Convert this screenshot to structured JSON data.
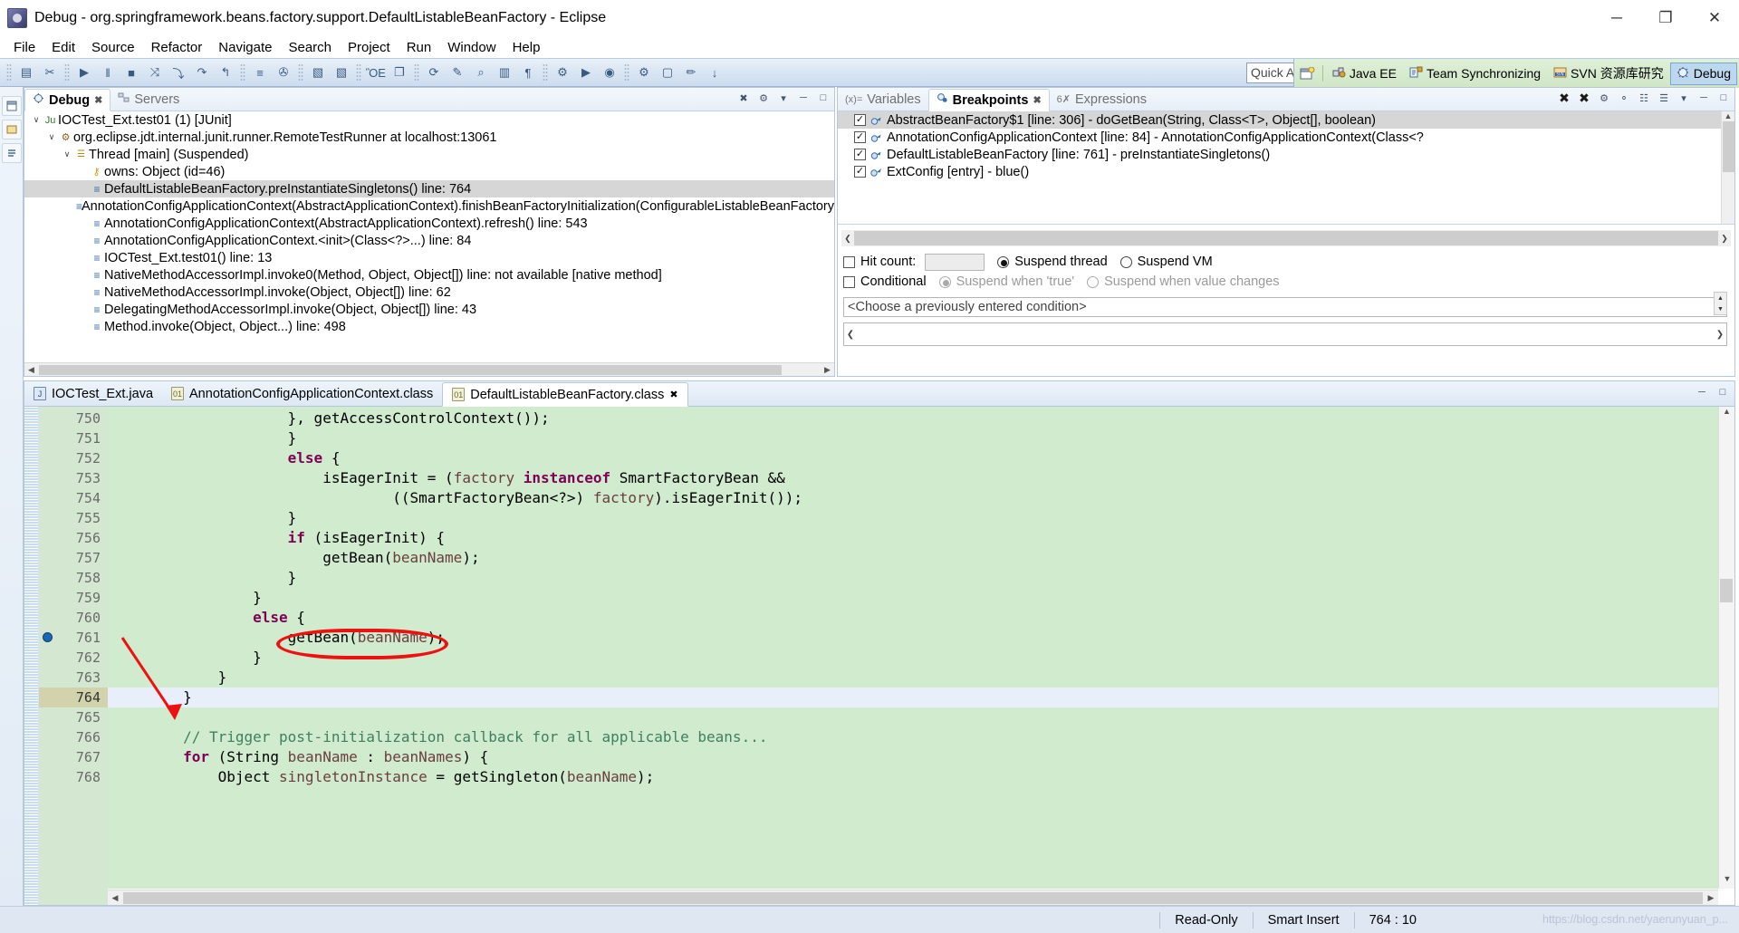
{
  "window": {
    "title": "Debug - org.springframework.beans.factory.support.DefaultListableBeanFactory - Eclipse",
    "app_icon": "eclipse-icon",
    "minimize": "─",
    "maximize": "❐",
    "close": "✕"
  },
  "menu": {
    "items": [
      "File",
      "Edit",
      "Source",
      "Refactor",
      "Navigate",
      "Search",
      "Project",
      "Run",
      "Window",
      "Help"
    ]
  },
  "toolbar": {
    "quick_access_placeholder": "Quick Access",
    "groups": [
      {
        "buttons": [
          {
            "name": "new-wizard-icon",
            "glyph": "▤"
          },
          {
            "name": "link-editor-icon",
            "glyph": "✂"
          }
        ]
      },
      {
        "buttons": [
          {
            "name": "resume-icon",
            "glyph": "▶"
          },
          {
            "name": "suspend-icon",
            "glyph": "‖"
          },
          {
            "name": "terminate-icon",
            "glyph": "■"
          },
          {
            "name": "disconnect-icon",
            "glyph": "⤨"
          },
          {
            "name": "step-into-icon",
            "glyph": "⤵"
          },
          {
            "name": "step-over-icon",
            "glyph": "↷"
          },
          {
            "name": "step-return-icon",
            "glyph": "↰"
          }
        ]
      },
      {
        "buttons": [
          {
            "name": "drop-to-frame-icon",
            "glyph": "≡"
          },
          {
            "name": "use-step-filters-icon",
            "glyph": "✇"
          }
        ]
      },
      {
        "buttons": [
          {
            "name": "new-java-file-icon",
            "glyph": "▧"
          },
          {
            "name": "new-folder-icon",
            "glyph": "▧"
          }
        ]
      },
      {
        "buttons": [
          {
            "name": "save-icon",
            "glyph": "ὋE"
          },
          {
            "name": "save-all-icon",
            "glyph": "❐"
          }
        ]
      },
      {
        "buttons": [
          {
            "name": "publish-icon",
            "glyph": "⟳"
          },
          {
            "name": "highlight-icon",
            "glyph": "✎"
          },
          {
            "name": "search-icon",
            "glyph": "⌕"
          },
          {
            "name": "open-type-icon",
            "glyph": "▥"
          },
          {
            "name": "toggle-mark-occurrences-icon",
            "glyph": "¶"
          }
        ]
      },
      {
        "buttons": [
          {
            "name": "debug-as-icon",
            "glyph": "⚙"
          },
          {
            "name": "run-as-icon",
            "glyph": "▶"
          },
          {
            "name": "coverage-as-icon",
            "glyph": "◉"
          }
        ]
      },
      {
        "buttons": [
          {
            "name": "external-tools-icon",
            "glyph": "⚙"
          },
          {
            "name": "open-perspective-icon",
            "glyph": "▢"
          },
          {
            "name": "search-pencil-icon",
            "glyph": "✏"
          },
          {
            "name": "next-annotation-icon",
            "glyph": "↓"
          }
        ]
      }
    ],
    "perspectives": [
      {
        "name": "open-perspective-button",
        "icon": "open-perspective-icon",
        "label": ""
      },
      {
        "name": "perspective-java-ee",
        "icon": "java-ee-icon",
        "label": "Java EE",
        "selected": false
      },
      {
        "name": "perspective-team-sync",
        "icon": "team-sync-icon",
        "label": "Team Synchronizing",
        "selected": false
      },
      {
        "name": "perspective-svn",
        "icon": "svn-icon",
        "label": "SVN 资源库研究",
        "selected": false
      },
      {
        "name": "perspective-debug",
        "icon": "debug-icon",
        "label": "Debug",
        "selected": true
      }
    ]
  },
  "debug_view": {
    "tabs": [
      {
        "label": "Debug",
        "icon": "debug-icon",
        "selected": true,
        "closeable": true
      },
      {
        "label": "Servers",
        "icon": "servers-icon",
        "selected": false,
        "closeable": false
      }
    ],
    "tools": [
      "collapse-all-icon",
      "view-menu-icon",
      "minimize-icon",
      "maximize-icon"
    ],
    "tree": [
      {
        "indent": 0,
        "twisty": "∨",
        "icon": "junit-icon",
        "icon_glyph": "Ju",
        "label": "IOCTest_Ext.test01 (1) [JUnit]",
        "selected": false
      },
      {
        "indent": 1,
        "twisty": "∨",
        "icon": "remote-runner-icon",
        "icon_glyph": "⚙",
        "label": "org.eclipse.jdt.internal.junit.runner.RemoteTestRunner at localhost:13061",
        "selected": false
      },
      {
        "indent": 2,
        "twisty": "∨",
        "icon": "thread-icon",
        "icon_glyph": "☰",
        "label": "Thread [main] (Suspended)",
        "selected": false
      },
      {
        "indent": 3,
        "twisty": "",
        "icon": "monitor-key-icon",
        "icon_glyph": "⚷",
        "label": "owns: Object  (id=46)",
        "selected": false
      },
      {
        "indent": 3,
        "twisty": "",
        "icon": "stack-frame-icon",
        "icon_glyph": "≡",
        "label": "DefaultListableBeanFactory.preInstantiateSingletons() line: 764",
        "selected": true
      },
      {
        "indent": 3,
        "twisty": "",
        "icon": "stack-frame-icon",
        "icon_glyph": "≡",
        "label": "AnnotationConfigApplicationContext(AbstractApplicationContext).finishBeanFactoryInitialization(ConfigurableListableBeanFactory) l",
        "selected": false
      },
      {
        "indent": 3,
        "twisty": "",
        "icon": "stack-frame-icon",
        "icon_glyph": "≡",
        "label": "AnnotationConfigApplicationContext(AbstractApplicationContext).refresh() line: 543",
        "selected": false
      },
      {
        "indent": 3,
        "twisty": "",
        "icon": "stack-frame-icon",
        "icon_glyph": "≡",
        "label": "AnnotationConfigApplicationContext.<init>(Class<?>...) line: 84",
        "selected": false
      },
      {
        "indent": 3,
        "twisty": "",
        "icon": "stack-frame-icon",
        "icon_glyph": "≡",
        "label": "IOCTest_Ext.test01() line: 13",
        "selected": false
      },
      {
        "indent": 3,
        "twisty": "",
        "icon": "stack-frame-icon",
        "icon_glyph": "≡",
        "label": "NativeMethodAccessorImpl.invoke0(Method, Object, Object[]) line: not available [native method]",
        "selected": false
      },
      {
        "indent": 3,
        "twisty": "",
        "icon": "stack-frame-icon",
        "icon_glyph": "≡",
        "label": "NativeMethodAccessorImpl.invoke(Object, Object[]) line: 62",
        "selected": false
      },
      {
        "indent": 3,
        "twisty": "",
        "icon": "stack-frame-icon",
        "icon_glyph": "≡",
        "label": "DelegatingMethodAccessorImpl.invoke(Object, Object[]) line: 43",
        "selected": false
      },
      {
        "indent": 3,
        "twisty": "",
        "icon": "stack-frame-icon",
        "icon_glyph": "≡",
        "label": "Method.invoke(Object, Object...) line: 498",
        "selected": false
      }
    ]
  },
  "breakpoints_view": {
    "tabs": [
      {
        "label": "Variables",
        "icon": "variables-icon",
        "selected": false,
        "closeable": false
      },
      {
        "label": "Breakpoints",
        "icon": "breakpoint-icon",
        "selected": true,
        "closeable": true
      },
      {
        "label": "Expressions",
        "icon": "expressions-icon",
        "selected": false,
        "closeable": false
      }
    ],
    "tools": [
      "remove-breakpoint-icon",
      "remove-all-icon",
      "link-icon",
      "skip-all-icon",
      "expand-all-icon",
      "collapse-all-icon",
      "view-menu-icon",
      "minimize-icon",
      "maximize-icon"
    ],
    "rows": [
      {
        "checked": true,
        "icon": "java-line-breakpoint-icon",
        "label": "AbstractBeanFactory$1 [line: 306] - doGetBean(String, Class<T>, Object[], boolean)",
        "selected": true
      },
      {
        "checked": true,
        "icon": "java-line-breakpoint-icon",
        "label": "AnnotationConfigApplicationContext [line: 84] - AnnotationConfigApplicationContext(Class<?",
        "selected": false
      },
      {
        "checked": true,
        "icon": "java-line-breakpoint-icon",
        "label": "DefaultListableBeanFactory [line: 761] - preInstantiateSingletons()",
        "selected": false
      },
      {
        "checked": true,
        "icon": "java-method-breakpoint-icon",
        "label": "ExtConfig [entry] - blue()",
        "selected": false
      }
    ],
    "detail": {
      "hit_count_label": "Hit count:",
      "hit_count_value": "",
      "hit_count_checked": false,
      "suspend_thread_label": "Suspend thread",
      "suspend_thread_selected": true,
      "suspend_vm_label": "Suspend VM",
      "suspend_vm_selected": false,
      "conditional_label": "Conditional",
      "conditional_checked": false,
      "suspend_when_true_label": "Suspend when 'true'",
      "suspend_when_true_selected": true,
      "suspend_when_changes_label": "Suspend when value changes",
      "suspend_when_changes_selected": false,
      "condition_combo_value": "<Choose a previously entered condition>",
      "condition_editor_value": ""
    }
  },
  "editor": {
    "tabs": [
      {
        "label": "IOCTest_Ext.java",
        "icon": "java-file-icon",
        "selected": false,
        "closeable": false
      },
      {
        "label": "AnnotationConfigApplicationContext.class",
        "icon": "class-file-icon",
        "selected": false,
        "closeable": false
      },
      {
        "label": "DefaultListableBeanFactory.class",
        "icon": "class-file-icon",
        "selected": true,
        "closeable": true
      }
    ],
    "tools": [
      "minimize-icon",
      "maximize-icon"
    ],
    "current_line": 764,
    "breakpoint_line": 761,
    "lines": [
      {
        "num": "750",
        "current": false,
        "breakpoint": false,
        "tokens": [
          {
            "t": "plain",
            "v": "                    }, getAccessControlContext());"
          }
        ]
      },
      {
        "num": "751",
        "current": false,
        "breakpoint": false,
        "tokens": [
          {
            "t": "plain",
            "v": "                    }"
          }
        ]
      },
      {
        "num": "752",
        "current": false,
        "breakpoint": false,
        "tokens": [
          {
            "t": "plain",
            "v": "                    "
          },
          {
            "t": "kw",
            "v": "else"
          },
          {
            "t": "plain",
            "v": " {"
          }
        ]
      },
      {
        "num": "753",
        "current": false,
        "breakpoint": false,
        "tokens": [
          {
            "t": "plain",
            "v": "                        isEagerInit = ("
          },
          {
            "t": "var",
            "v": "factory"
          },
          {
            "t": "plain",
            "v": " "
          },
          {
            "t": "kw",
            "v": "instanceof"
          },
          {
            "t": "plain",
            "v": " SmartFactoryBean &&"
          }
        ]
      },
      {
        "num": "754",
        "current": false,
        "breakpoint": false,
        "tokens": [
          {
            "t": "plain",
            "v": "                                ((SmartFactoryBean<?>) "
          },
          {
            "t": "var",
            "v": "factory"
          },
          {
            "t": "plain",
            "v": ").isEagerInit());"
          }
        ]
      },
      {
        "num": "755",
        "current": false,
        "breakpoint": false,
        "tokens": [
          {
            "t": "plain",
            "v": "                    }"
          }
        ]
      },
      {
        "num": "756",
        "current": false,
        "breakpoint": false,
        "tokens": [
          {
            "t": "plain",
            "v": "                    "
          },
          {
            "t": "kw",
            "v": "if"
          },
          {
            "t": "plain",
            "v": " (isEagerInit) {"
          }
        ]
      },
      {
        "num": "757",
        "current": false,
        "breakpoint": false,
        "tokens": [
          {
            "t": "plain",
            "v": "                        getBean("
          },
          {
            "t": "var",
            "v": "beanName"
          },
          {
            "t": "plain",
            "v": ");"
          }
        ]
      },
      {
        "num": "758",
        "current": false,
        "breakpoint": false,
        "tokens": [
          {
            "t": "plain",
            "v": "                    }"
          }
        ]
      },
      {
        "num": "759",
        "current": false,
        "breakpoint": false,
        "tokens": [
          {
            "t": "plain",
            "v": "                }"
          }
        ]
      },
      {
        "num": "760",
        "current": false,
        "breakpoint": false,
        "tokens": [
          {
            "t": "plain",
            "v": "                "
          },
          {
            "t": "kw",
            "v": "else"
          },
          {
            "t": "plain",
            "v": " {"
          }
        ]
      },
      {
        "num": "761",
        "current": false,
        "breakpoint": true,
        "tokens": [
          {
            "t": "plain",
            "v": "                    getBean("
          },
          {
            "t": "var",
            "v": "beanName"
          },
          {
            "t": "plain",
            "v": ");"
          }
        ]
      },
      {
        "num": "762",
        "current": false,
        "breakpoint": false,
        "tokens": [
          {
            "t": "plain",
            "v": "                }"
          }
        ]
      },
      {
        "num": "763",
        "current": false,
        "breakpoint": false,
        "tokens": [
          {
            "t": "plain",
            "v": "            }"
          }
        ]
      },
      {
        "num": "764",
        "current": true,
        "breakpoint": false,
        "tokens": [
          {
            "t": "plain",
            "v": "        }"
          }
        ]
      },
      {
        "num": "765",
        "current": false,
        "breakpoint": false,
        "tokens": [
          {
            "t": "plain",
            "v": ""
          }
        ]
      },
      {
        "num": "766",
        "current": false,
        "breakpoint": false,
        "tokens": [
          {
            "t": "cmt",
            "v": "        // Trigger post-initialization callback for all applicable beans..."
          }
        ]
      },
      {
        "num": "767",
        "current": false,
        "breakpoint": false,
        "tokens": [
          {
            "t": "plain",
            "v": "        "
          },
          {
            "t": "kw",
            "v": "for"
          },
          {
            "t": "plain",
            "v": " ("
          },
          {
            "t": "plain",
            "v": "String"
          },
          {
            "t": "plain",
            "v": " "
          },
          {
            "t": "var",
            "v": "beanName"
          },
          {
            "t": "plain",
            "v": " : "
          },
          {
            "t": "var",
            "v": "beanNames"
          },
          {
            "t": "plain",
            "v": ") {"
          }
        ]
      },
      {
        "num": "768",
        "current": false,
        "breakpoint": false,
        "tokens": [
          {
            "t": "plain",
            "v": "            Object "
          },
          {
            "t": "var",
            "v": "singletonInstance"
          },
          {
            "t": "plain",
            "v": " = getSingleton("
          },
          {
            "t": "var",
            "v": "beanName"
          },
          {
            "t": "plain",
            "v": ");"
          }
        ]
      }
    ],
    "annotation": {
      "circle_target": "getBean(beanName)",
      "arrow_target_line": "764",
      "color": "#ee1111"
    }
  },
  "statusbar": {
    "read_only": "Read-Only",
    "insert_mode": "Smart Insert",
    "position": "764 : 10",
    "watermark": "https://blog.csdn.net/yaerunyuan_p..."
  },
  "colors": {
    "code_bg": "#d0ebce",
    "current_line_bg": "#e8effa",
    "gutter_bg": "#d4e8d1",
    "annotation_red": "#ee1111",
    "selection_gray": "#d6d6d6",
    "perspective_bar": "#dff0d8"
  }
}
